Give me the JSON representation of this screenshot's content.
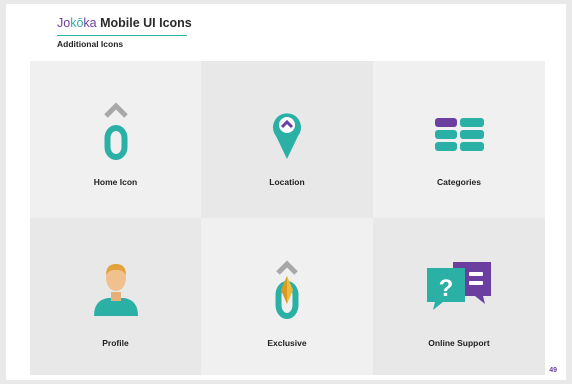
{
  "header": {
    "brand_part1": "Jo",
    "brand_part2": "kō",
    "brand_part3": "ka",
    "brand_rest": " Mobile UI Icons",
    "subtitle": "Additional Icons"
  },
  "tiles": [
    {
      "label": "Home Icon",
      "icon": "home-icon"
    },
    {
      "label": "Location",
      "icon": "location-pin-icon"
    },
    {
      "label": "Categories",
      "icon": "categories-icon"
    },
    {
      "label": "Profile",
      "icon": "profile-icon"
    },
    {
      "label": "Exclusive",
      "icon": "exclusive-icon"
    },
    {
      "label": "Online Support",
      "icon": "online-support-icon"
    }
  ],
  "page_number": "49",
  "colors": {
    "teal": "#2ab0a5",
    "purple": "#6b3fa0",
    "gray": "#a8a8a8",
    "gold": "#f0b93a"
  }
}
